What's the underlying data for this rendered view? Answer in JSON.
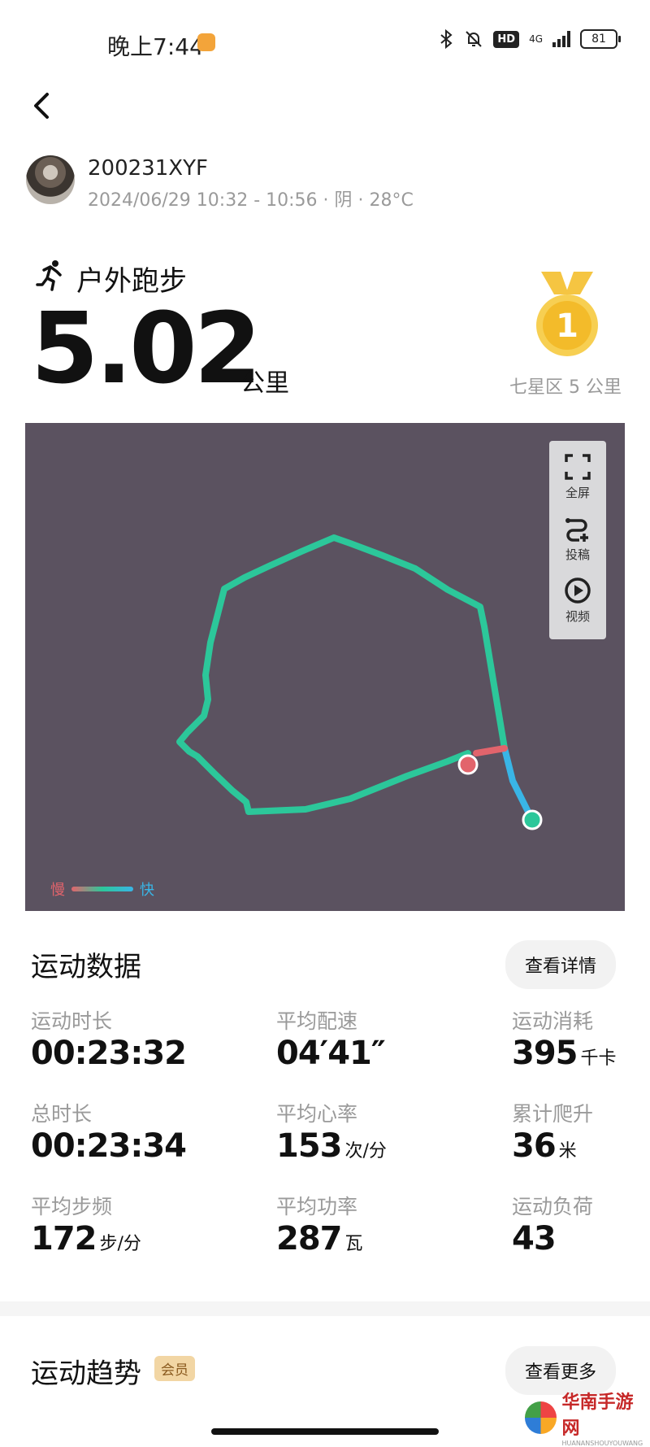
{
  "status_bar": {
    "time": "晚上7:44",
    "network": "4G",
    "hd": "HD",
    "battery": "81"
  },
  "user": {
    "name": "200231XYF",
    "meta": "2024/06/29 10:32 - 10:56 · 阴 · 28°C"
  },
  "activity": {
    "type": "户外跑步",
    "distance": "5.02",
    "unit": "公里",
    "medal_number": "1",
    "medal_label": "七星区 5 公里"
  },
  "map": {
    "tools": [
      {
        "icon": "fullscreen-icon",
        "label": "全屏"
      },
      {
        "icon": "route-share-icon",
        "label": "投稿"
      },
      {
        "icon": "play-video-icon",
        "label": "视频"
      }
    ],
    "legend_slow": "慢",
    "legend_fast": "快",
    "colors": {
      "background": "#5b5260",
      "route": "#2cc79a",
      "start": "#2cc79a",
      "end": "#e2646c"
    }
  },
  "workout_data": {
    "title": "运动数据",
    "detail_button": "查看详情",
    "stats": [
      {
        "label": "运动时长",
        "value": "00:23:32",
        "unit": ""
      },
      {
        "label": "平均配速",
        "value": "04′41″",
        "unit": ""
      },
      {
        "label": "运动消耗",
        "value": "395",
        "unit": "千卡"
      },
      {
        "label": "总时长",
        "value": "00:23:34",
        "unit": ""
      },
      {
        "label": "平均心率",
        "value": "153",
        "unit": "次/分"
      },
      {
        "label": "累计爬升",
        "value": "36",
        "unit": "米"
      },
      {
        "label": "平均步频",
        "value": "172",
        "unit": "步/分"
      },
      {
        "label": "平均功率",
        "value": "287",
        "unit": "瓦"
      },
      {
        "label": "运动负荷",
        "value": "43",
        "unit": ""
      }
    ]
  },
  "trend": {
    "title": "运动趋势",
    "tag": "会员",
    "more_button": "查看更多"
  },
  "watermark": {
    "text": "华南手游网",
    "sub": "HUANANSHOUYOUWANG"
  }
}
